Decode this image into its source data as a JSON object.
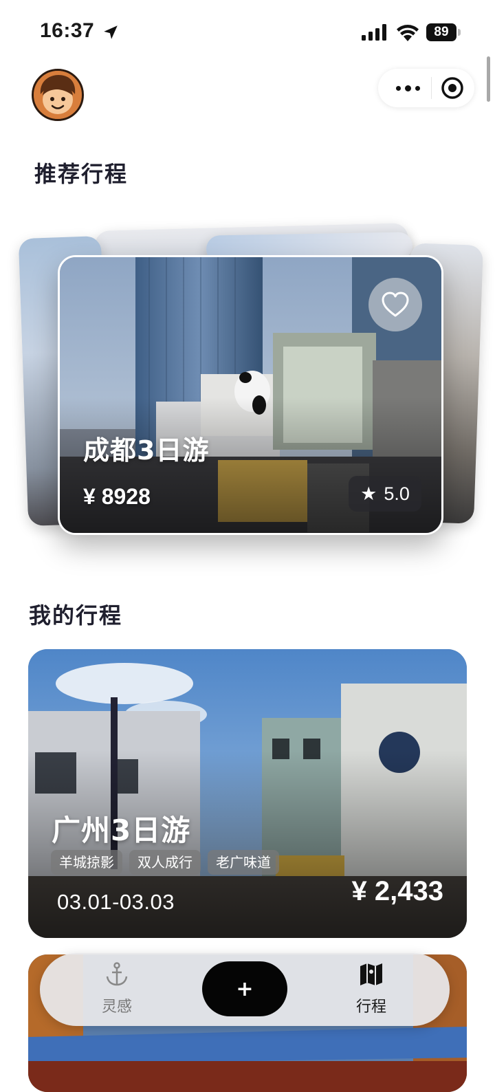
{
  "status_bar": {
    "time": "16:37",
    "battery": "89"
  },
  "header": {
    "avatar": "avatar",
    "capsule": {
      "more": "more-icon",
      "target": "target-icon"
    }
  },
  "recommended": {
    "title": "推荐行程",
    "card": {
      "name": "成都3日游",
      "price": "¥ 8928",
      "rating": "5.0",
      "favorite_icon": "heart-icon"
    }
  },
  "my_trips": {
    "title": "我的行程",
    "trips": [
      {
        "name": "广州3日游",
        "tags": [
          "羊城掠影",
          "双人成行",
          "老广味道"
        ],
        "dates": "03.01-03.03",
        "price": "¥ 2,433"
      }
    ]
  },
  "tabbar": {
    "items": [
      {
        "label": "灵感",
        "icon": "anchor-icon"
      },
      {
        "label": "+",
        "icon": "plus-icon"
      },
      {
        "label": "行程",
        "icon": "map-icon"
      }
    ]
  }
}
